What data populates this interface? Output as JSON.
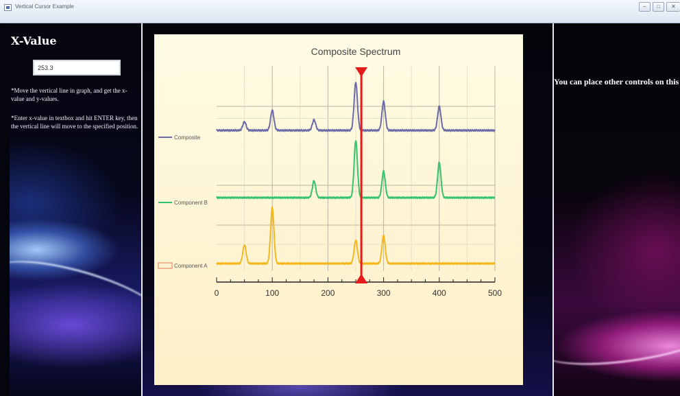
{
  "window": {
    "title": "Vertical Cursor Example",
    "buttons": {
      "minimize": "–",
      "maximize": "□",
      "close": "✕"
    }
  },
  "left_panel": {
    "heading": "X-Value",
    "input_value": "253.3",
    "instruction_1": "*Move the vertical line in graph, and get the x-value and y-values.",
    "instruction_2": "*Enter x-value in textbox and hit ENTER key, then the vertical line will move to the specified position."
  },
  "right_panel": {
    "note": "You can place other controls on this side."
  },
  "colors": {
    "composite": "#6b6ba8",
    "component_b": "#35c46e",
    "component_a": "#f2b81e",
    "cursor": "#e31b1b",
    "chart_bg": "#fff8dc"
  },
  "chart_data": {
    "type": "line",
    "title": "Composite Spectrum",
    "xlim": [
      0,
      500
    ],
    "x_ticks": [
      0,
      100,
      200,
      300,
      400,
      500
    ],
    "grid": true,
    "legend_position": "left",
    "cursor_x": 260,
    "series": [
      {
        "name": "Composite",
        "color": "#6b6ba8",
        "baseline": 0,
        "peaks": [
          [
            50,
            0.18
          ],
          [
            100,
            0.42
          ],
          [
            175,
            0.22
          ],
          [
            250,
            1.0
          ],
          [
            300,
            0.6
          ],
          [
            400,
            0.5
          ]
        ]
      },
      {
        "name": "Component B",
        "color": "#35c46e",
        "baseline": 0,
        "peaks": [
          [
            175,
            0.38
          ],
          [
            250,
            1.3
          ],
          [
            300,
            0.6
          ],
          [
            400,
            0.8
          ]
        ]
      },
      {
        "name": "Component A",
        "color": "#f2b81e",
        "baseline": 0,
        "peaks": [
          [
            50,
            0.4
          ],
          [
            100,
            1.2
          ],
          [
            250,
            0.5
          ],
          [
            300,
            0.6
          ]
        ]
      }
    ]
  }
}
